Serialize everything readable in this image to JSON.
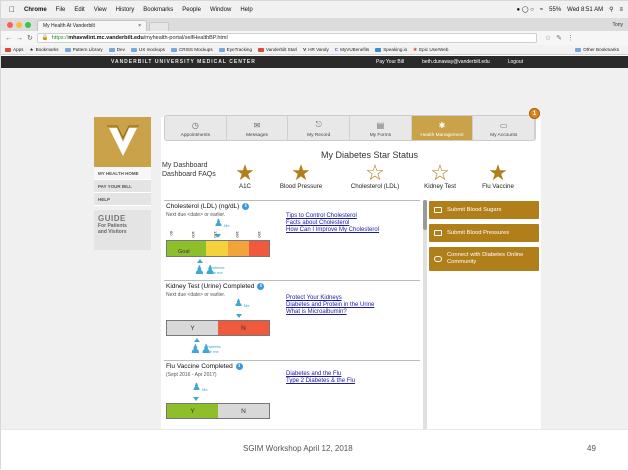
{
  "menubar": {
    "app": "Chrome",
    "items": [
      "File",
      "Edit",
      "View",
      "History",
      "Bookmarks",
      "People",
      "Window",
      "Help"
    ],
    "battery": "55%",
    "clock": "Wed 8:51 AM"
  },
  "browser": {
    "tab_title": "My Health At Vanderbilt",
    "user": "Tony",
    "url_scheme": "https://",
    "url_host": "mhavwlint.mc.vanderbilt.edu",
    "url_path": "/myhealth-portal/selfHealthBP.html",
    "bookmarks": [
      "Apps",
      "Bookmarks",
      "Pattern Library",
      "Dev",
      "UX mockups",
      "CRISS Mockups",
      "EyeTracking",
      "Vanderbilt Starl",
      "HR Vandy",
      "MyVUBenefits",
      "Speaking.io",
      "Epic UserWeb"
    ],
    "other_bookmarks": "Other Bookmarks"
  },
  "header": {
    "title": "VANDERBILT UNIVERSITY MEDICAL CENTER",
    "pay_bill": "Pay Your Bill",
    "email": "beth.dunaway@vanderbilt.edu",
    "logout": "Logout"
  },
  "sidebar": {
    "items": [
      "MY HEALTH HOME",
      "PAY YOUR BILL",
      "HELP"
    ],
    "guide_title": "GUIDE",
    "guide_sub1": "For Patients",
    "guide_sub2": "and Visitors"
  },
  "nav": {
    "tabs": [
      {
        "label": "Appointments",
        "icon": "clock-icon"
      },
      {
        "label": "Messages",
        "icon": "envelope-icon"
      },
      {
        "label": "My Record",
        "icon": "record-icon"
      },
      {
        "label": "My Forms",
        "icon": "forms-icon"
      },
      {
        "label": "Health Management",
        "icon": "runner-icon"
      },
      {
        "label": "My Accounts",
        "icon": "lock-icon"
      }
    ],
    "badge": "1"
  },
  "dashboard": {
    "link1": "My Dashboard",
    "link2": "Dashboard FAQs",
    "star_title": "My Diabetes Star Status",
    "stars": [
      {
        "label": "A1C",
        "filled": true
      },
      {
        "label": "Blood Pressure",
        "filled": true
      },
      {
        "label": "Cholesterol (LDL)",
        "filled": false
      },
      {
        "label": "Kidney Test",
        "filled": false
      },
      {
        "label": "Flu Vaccine",
        "filled": true
      }
    ]
  },
  "sections": {
    "cholesterol": {
      "title": "Cholesterol (LDL) (ng/dL)",
      "sub": "Next due <date> or earlier.",
      "links": [
        "Tips to Control Cholesterol",
        "Facts about Cholesterol",
        "How Can I Improve My Cholesterol"
      ],
      "ticks": [
        "60",
        "100",
        "130",
        "160",
        "190"
      ],
      "goal": "Goal",
      "me": "Me",
      "patients": "Patients",
      "like_me": "like me"
    },
    "kidney": {
      "title": "Kidney Test (Urine) Completed",
      "sub": "Next due <date> or earlier.",
      "links": [
        "Protect Your Kidneys",
        "Diabetes and Protein in the Urine",
        "What is Microalbumin?"
      ],
      "yes": "Y",
      "no": "N",
      "me": "Me",
      "patients": "Patients",
      "like_me": "like me"
    },
    "flu": {
      "title": "Flu Vaccine Completed",
      "sub": "(Sept 2016 - Apr 2017)",
      "links": [
        "Diabetes and the Flu",
        "Type 2 Diabetes & the Flu"
      ],
      "yes": "Y",
      "no": "N",
      "me": "Me"
    }
  },
  "actions": [
    "Submit Blood Sugars",
    "Submit Blood Pressures",
    "Connect with Diabetes Online Community"
  ],
  "footer": {
    "text": "SGIM Workshop April 12, 2018",
    "page": "49"
  }
}
